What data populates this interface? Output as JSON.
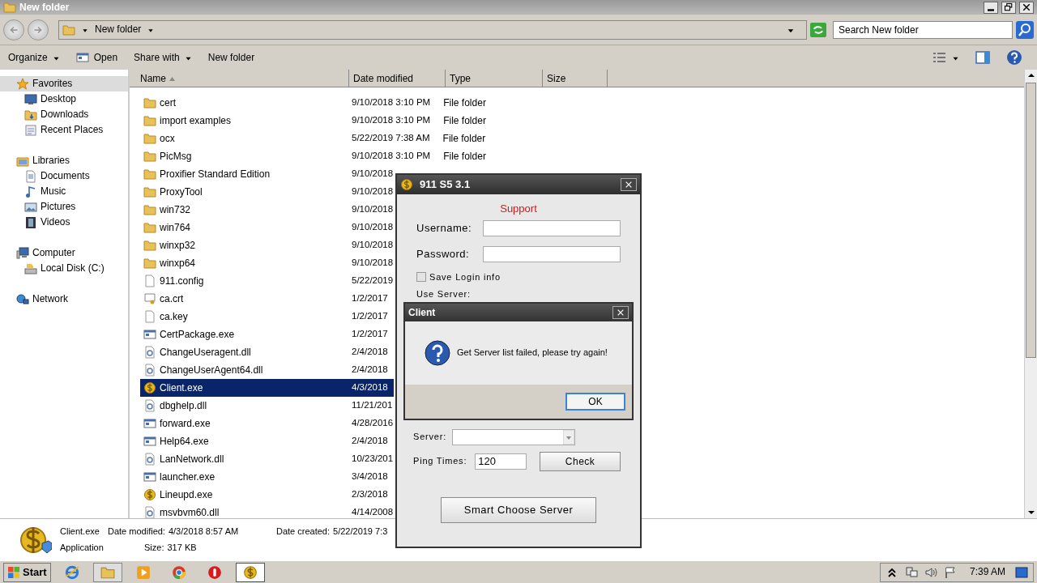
{
  "window": {
    "title": "New folder"
  },
  "address": {
    "path": "New folder",
    "search_placeholder": "Search New folder"
  },
  "toolbar": [
    {
      "label": "Organize",
      "kind": "menu"
    },
    {
      "label": "Open",
      "kind": "open"
    },
    {
      "label": "Share with",
      "kind": "menu"
    },
    {
      "label": "New folder",
      "kind": "plain"
    }
  ],
  "sidebar": [
    {
      "label": "Favorites",
      "kind": "star",
      "selected": true,
      "children": [
        {
          "label": "Desktop",
          "kind": "desktop",
          "selected": false
        },
        {
          "label": "Downloads",
          "kind": "downloads",
          "selected": false
        },
        {
          "label": "Recent Places",
          "kind": "places",
          "selected": false
        }
      ]
    },
    {
      "label": "Libraries",
      "kind": "library",
      "selected": false,
      "children": [
        {
          "label": "Documents",
          "kind": "documents",
          "selected": false
        },
        {
          "label": "Music",
          "kind": "music",
          "selected": false
        },
        {
          "label": "Pictures",
          "kind": "pictures",
          "selected": false
        },
        {
          "label": "Videos",
          "kind": "videos",
          "selected": false
        }
      ]
    },
    {
      "label": "Computer",
      "kind": "computer",
      "selected": false,
      "children": [
        {
          "label": "Local Disk (C:)",
          "kind": "disk",
          "selected": false
        }
      ]
    },
    {
      "label": "Network",
      "kind": "network",
      "selected": false
    }
  ],
  "columns": [
    {
      "label": "Name",
      "sorted": true
    },
    {
      "label": "Date modified",
      "sorted": false
    },
    {
      "label": "Type",
      "sorted": false
    },
    {
      "label": "Size",
      "sorted": false
    }
  ],
  "files": [
    {
      "name": "cert",
      "date": "9/10/2018 3:10 PM",
      "type": "File folder",
      "kind": "folder",
      "selected": false
    },
    {
      "name": "import examples",
      "date": "9/10/2018 3:10 PM",
      "type": "File folder",
      "kind": "folder",
      "selected": false
    },
    {
      "name": "ocx",
      "date": "5/22/2019 7:38 AM",
      "type": "File folder",
      "kind": "folder",
      "selected": false
    },
    {
      "name": "PicMsg",
      "date": "9/10/2018 3:10 PM",
      "type": "File folder",
      "kind": "folder",
      "selected": false
    },
    {
      "name": "Proxifier Standard Edition",
      "date": "9/10/2018",
      "kind": "folder",
      "selected": false
    },
    {
      "name": "ProxyTool",
      "date": "9/10/2018",
      "kind": "folder",
      "selected": false
    },
    {
      "name": "win732",
      "date": "9/10/2018",
      "kind": "folder",
      "selected": false
    },
    {
      "name": "win764",
      "date": "9/10/2018",
      "kind": "folder",
      "selected": false
    },
    {
      "name": "winxp32",
      "date": "9/10/2018",
      "kind": "folder",
      "selected": false
    },
    {
      "name": "winxp64",
      "date": "9/10/2018",
      "kind": "folder",
      "selected": false
    },
    {
      "name": "911.config",
      "date": "5/22/2019",
      "kind": "file",
      "selected": false
    },
    {
      "name": "ca.crt",
      "date": "1/2/2017",
      "kind": "cert",
      "selected": false
    },
    {
      "name": "ca.key",
      "date": "1/2/2017",
      "kind": "file",
      "selected": false
    },
    {
      "name": "CertPackage.exe",
      "date": "1/2/2017",
      "kind": "exe",
      "selected": false
    },
    {
      "name": "ChangeUseragent.dll",
      "date": "2/4/2018",
      "kind": "dll",
      "selected": false
    },
    {
      "name": "ChangeUserAgent64.dll",
      "date": "2/4/2018",
      "kind": "dll",
      "selected": false
    },
    {
      "name": "Client.exe",
      "date": "4/3/2018",
      "kind": "coin",
      "selected": true
    },
    {
      "name": "dbghelp.dll",
      "date": "11/21/201",
      "kind": "dll",
      "selected": false
    },
    {
      "name": "forward.exe",
      "date": "4/28/2016",
      "kind": "exe",
      "selected": false
    },
    {
      "name": "Help64.exe",
      "date": "2/4/2018",
      "kind": "exe",
      "selected": false
    },
    {
      "name": "LanNetwork.dll",
      "date": "10/23/201",
      "kind": "dll",
      "selected": false
    },
    {
      "name": "launcher.exe",
      "date": "3/4/2018",
      "kind": "exe",
      "selected": false
    },
    {
      "name": "Lineupd.exe",
      "date": "2/3/2018",
      "kind": "coin",
      "selected": false
    },
    {
      "name": "msvbvm60.dll",
      "date": "4/14/2008",
      "kind": "dll",
      "selected": false
    }
  ],
  "details": {
    "name": "Client.exe",
    "type": "Application",
    "fields": [
      {
        "label": "Date modified:",
        "value": "4/3/2018 8:57 AM"
      },
      {
        "label": "Size:",
        "value": "317 KB"
      },
      {
        "label": "Date created:",
        "value": "5/22/2019 7:3"
      }
    ]
  },
  "app_dialog": {
    "title": "911 S5 3.1",
    "support": "Support",
    "username_label": "Username:",
    "password_label": "Password:",
    "save_login": {
      "label": "Save Login info",
      "checked": false
    },
    "use_server": "Use Server:",
    "server_label": "Server:",
    "ping_label": "Ping Times:",
    "ping_value": "120",
    "check_button": "Check",
    "smart_button": "Smart Choose Server"
  },
  "message_box": {
    "title": "Client",
    "message": "Get Server list failed, please try again!",
    "button": "OK"
  },
  "taskbar": {
    "start": "Start",
    "apps": [
      {
        "kind": "ie",
        "open": false,
        "selected": false
      },
      {
        "kind": "explorer",
        "open": true,
        "selected": false
      },
      {
        "kind": "player",
        "open": false,
        "selected": false
      },
      {
        "kind": "chrome",
        "open": false,
        "selected": false
      },
      {
        "kind": "opera",
        "open": false,
        "selected": false
      },
      {
        "kind": "coin",
        "open": true,
        "selected": true
      }
    ],
    "clock": "7:39 AM"
  }
}
